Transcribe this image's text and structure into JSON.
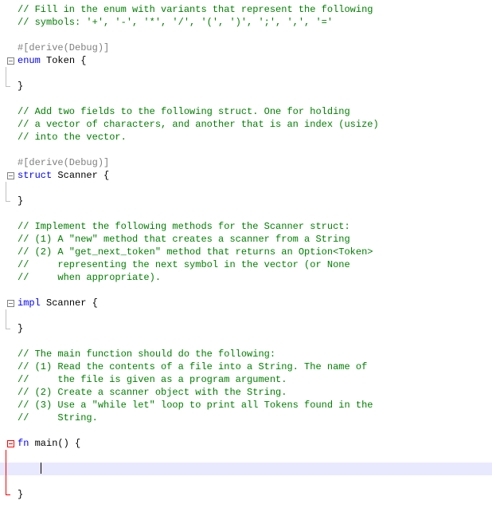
{
  "lines": {
    "c1": "// Fill in the enum with variants that represent the following",
    "c2": "// symbols: '+', '-', '*', '/', '(', ')', ';', ',', '='",
    "attr1": "#[derive(Debug)]",
    "enum_kw": "enum",
    "enum_name": " Token ",
    "lbrace": "{",
    "rbrace": "}",
    "c3": "// Add two fields to the following struct. One for holding",
    "c4": "// a vector of characters, and another that is an index (usize)",
    "c5": "// into the vector.",
    "attr2": "#[derive(Debug)]",
    "struct_kw": "struct",
    "struct_name": " Scanner ",
    "c6": "// Implement the following methods for the Scanner struct:",
    "c7": "// (1) A \"new\" method that creates a scanner from a String",
    "c8": "// (2) A \"get_next_token\" method that returns an Option<Token>",
    "c9": "//     representing the next symbol in the vector (or None",
    "c10": "//     when appropriate).",
    "impl_kw": "impl",
    "impl_name": " Scanner ",
    "c11": "// The main function should do the following:",
    "c12": "// (1) Read the contents of a file into a String. The name of",
    "c13": "//     the file is given as a program argument.",
    "c14": "// (2) Create a scanner object with the String.",
    "c15": "// (3) Use a \"while let\" loop to print all Tokens found in the",
    "c16": "//     String.",
    "fn_kw": "fn",
    "fn_name": " main() "
  }
}
